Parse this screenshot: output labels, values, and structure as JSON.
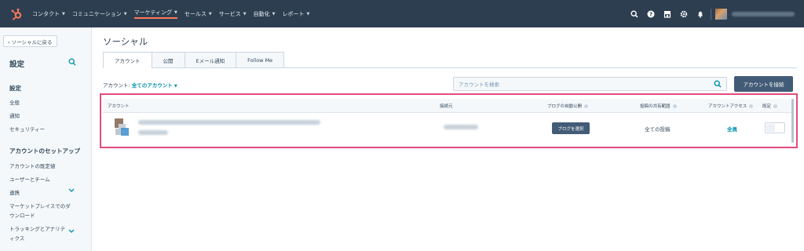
{
  "topnav": {
    "items": [
      {
        "label": "コンタクト"
      },
      {
        "label": "コミュニケーション"
      },
      {
        "label": "マーケティング"
      },
      {
        "label": "セールス"
      },
      {
        "label": "サービス"
      },
      {
        "label": "自動化"
      },
      {
        "label": "レポート"
      }
    ],
    "active_item": "マーケティング",
    "icons": [
      "search-icon",
      "help-icon",
      "marketplace-icon",
      "settings-icon",
      "notifications-icon"
    ]
  },
  "sidebar": {
    "back_label": "‹ ソーシャルに戻る",
    "title": "設定",
    "section_title": "設定",
    "items": [
      {
        "label": "全般"
      },
      {
        "label": "通知"
      },
      {
        "label": "セキュリティー"
      }
    ],
    "account_setup_title": "アカウントのセットアップ",
    "setup_items": [
      {
        "label": "アカウントの既定値"
      },
      {
        "label": "ユーザーとチーム"
      },
      {
        "label": "連携"
      },
      {
        "label": "マーケットプレイスでのダ"
      },
      {
        "label": "ウンロード"
      },
      {
        "label": "トラッキングとアナリテ"
      },
      {
        "label": "ィクス"
      }
    ]
  },
  "main": {
    "title": "ソーシャル",
    "tabs": [
      {
        "label": "アカウント"
      },
      {
        "label": "公開"
      },
      {
        "label": "Eメール通知"
      },
      {
        "label": "Follow Me"
      }
    ],
    "filter_label": "アカウント:",
    "filter_value": "全てのアカウント",
    "search_placeholder": "アカウントを検索",
    "connect_button": "アカウントを接続",
    "table": {
      "headers": {
        "account": "アカウント",
        "connected_to": "接続元",
        "auto_publish": "ブログの自動公開",
        "share_scope": "投稿の共有範囲",
        "access": "アカウントアクセス",
        "favorite": "既定"
      },
      "row": {
        "choose_blog_button": "ブログを選択",
        "share_scope": "全ての投稿",
        "access": "全員"
      }
    }
  },
  "colors": {
    "nav_bg": "#2d3e50",
    "accent_orange": "#ff7a59",
    "link": "#0091ae",
    "button_dark": "#425b76",
    "highlight_frame": "#e24c7d"
  }
}
